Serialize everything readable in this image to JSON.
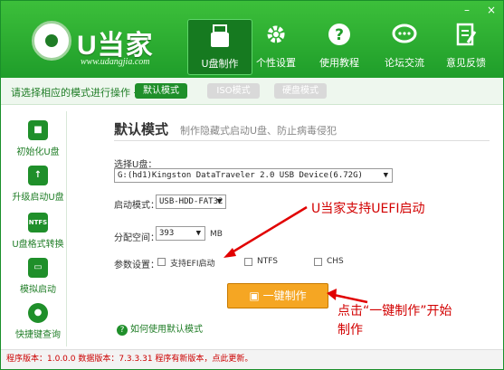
{
  "window": {
    "minimize": "–",
    "close": "×"
  },
  "logo": {
    "title": "U当家",
    "url": "www.udangjia.com"
  },
  "nav": [
    {
      "label": "U盘制作",
      "icon": "usb-icon"
    },
    {
      "label": "个性设置",
      "icon": "gear-icon"
    },
    {
      "label": "使用教程",
      "icon": "help-icon"
    },
    {
      "label": "论坛交流",
      "icon": "chat-icon"
    },
    {
      "label": "意见反馈",
      "icon": "feedback-icon"
    }
  ],
  "modes": {
    "hint": "请选择相应的模式进行操作 →",
    "items": [
      "默认模式",
      "ISO模式",
      "硬盘模式"
    ],
    "active": "默认模式"
  },
  "sidebar": [
    {
      "label": "初始化U盘",
      "icon": "init-usb-icon"
    },
    {
      "label": "升级启动U盘",
      "icon": "upgrade-usb-icon"
    },
    {
      "label": "U盘格式转换",
      "icon": "ntfs-icon",
      "icon_text": "NTFS"
    },
    {
      "label": "模拟启动",
      "icon": "monitor-icon"
    },
    {
      "label": "快捷键查询",
      "icon": "location-icon"
    }
  ],
  "main": {
    "title": "默认模式",
    "desc": "制作隐藏式启动U盘、防止病毒侵犯",
    "select_usb_label": "选择U盘：",
    "usb_value": "G:(hd1)Kingston DataTraveler 2.0 USB Device(6.72G)",
    "boot_mode_label": "启动模式：",
    "boot_mode_value": "USB-HDD-FAT32",
    "partition_label": "分配空间：",
    "partition_value": "393",
    "partition_unit": "MB",
    "params_label": "参数设置：",
    "opt_efi": "支持EFI启动",
    "opt_ntfs": "NTFS",
    "opt_chs": "CHS",
    "make_button": "一键制作",
    "help_link": "如何使用默认模式"
  },
  "status": {
    "text": "程序版本：1.0.0.0   数据版本：7.3.3.31 程序有新版本，点此更新。"
  },
  "annotations": {
    "uefi": "U当家支持UEFI启动",
    "click_make": "点击“一键制作”开始制作"
  }
}
